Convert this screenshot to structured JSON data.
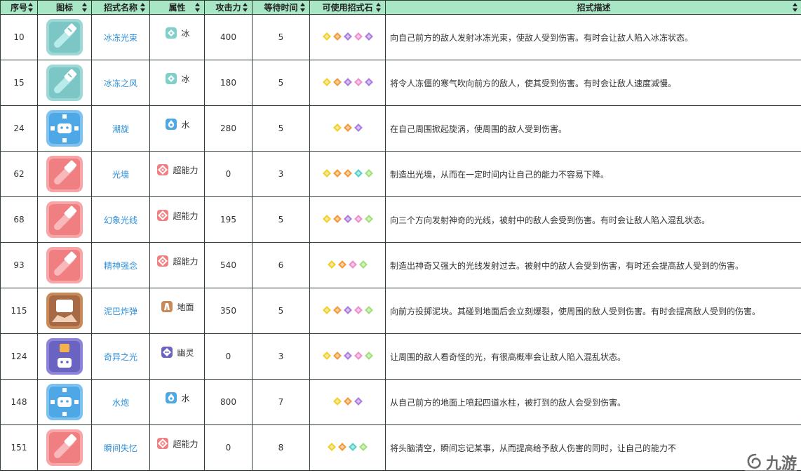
{
  "headers": [
    {
      "key": "idx",
      "label": "序号"
    },
    {
      "key": "icon",
      "label": "图标"
    },
    {
      "key": "name",
      "label": "招式名称"
    },
    {
      "key": "attr",
      "label": "属性"
    },
    {
      "key": "atk",
      "label": "攻击力"
    },
    {
      "key": "wait",
      "label": "等待时间"
    },
    {
      "key": "stones",
      "label": "可使用招式石"
    },
    {
      "key": "desc",
      "label": "招式描述"
    }
  ],
  "colors": {
    "header_bg": "#a9e6c5",
    "link": "#2e8fd8",
    "ice": "#8fd3d6",
    "water": "#4ea8e6",
    "psychic": "#f07f82",
    "ground": "#b06e48",
    "ghost": "#6a63c2"
  },
  "stone_colors": {
    "yellow": "#f2d02a",
    "orange": "#f39a3a",
    "purple": "#a97ee0",
    "pink": "#ee8fc9",
    "green": "#9fe07a",
    "teal": "#56d0c8"
  },
  "rows": [
    {
      "id": "10",
      "name": "冰冻光束",
      "type": "冰",
      "type_key": "ice",
      "icon": "ice-beam-icon",
      "atk": "400",
      "wait": "5",
      "stones": [
        "yellow",
        "orange",
        "purple",
        "pink",
        "purple"
      ],
      "desc": "向自己前方的敌人发射冰冻光束，使敌人受到伤害。有时会让敌人陷入冰冻状态。"
    },
    {
      "id": "15",
      "name": "冰冻之风",
      "type": "冰",
      "type_key": "ice",
      "icon": "ice-wind-icon",
      "atk": "180",
      "wait": "5",
      "stones": [
        "yellow",
        "orange",
        "purple",
        "pink",
        "purple"
      ],
      "desc": "将令人冻僵的寒气吹向前方的敌人，使其受到伤害。有时会让敌人速度减慢。"
    },
    {
      "id": "24",
      "name": "潮旋",
      "type": "水",
      "type_key": "water",
      "icon": "whirlpool-icon",
      "atk": "280",
      "wait": "5",
      "stones": [
        "yellow",
        "orange",
        "purple"
      ],
      "desc": "在自己周围掀起旋涡，使周围的敌人受到伤害。"
    },
    {
      "id": "62",
      "name": "光墙",
      "type": "超能力",
      "type_key": "psychic",
      "icon": "light-screen-icon",
      "atk": "0",
      "wait": "3",
      "stones": [
        "yellow",
        "orange",
        "orange",
        "teal",
        "green"
      ],
      "desc": "制造出光墙，从而在一定时间内让自己的能力不容易下降。"
    },
    {
      "id": "68",
      "name": "幻象光线",
      "type": "超能力",
      "type_key": "psychic",
      "icon": "psybeam-icon",
      "atk": "195",
      "wait": "5",
      "stones": [
        "yellow",
        "orange",
        "purple",
        "pink",
        "green"
      ],
      "desc": "向三个方向发射神奇的光线，被射中的敌人会受到伤害。有时会让敌人陷入混乱状态。"
    },
    {
      "id": "93",
      "name": "精神强念",
      "type": "超能力",
      "type_key": "psychic",
      "icon": "psychic-icon",
      "atk": "540",
      "wait": "6",
      "stones": [
        "yellow",
        "orange",
        "pink",
        "green"
      ],
      "desc": "制造出神奇又强大的光线发射过去。被射中的敌人会受到伤害，有时还会提高敌人受到的伤害。"
    },
    {
      "id": "115",
      "name": "泥巴炸弹",
      "type": "地面",
      "type_key": "ground",
      "icon": "mud-bomb-icon",
      "atk": "350",
      "wait": "5",
      "stones": [
        "yellow",
        "orange",
        "purple",
        "pink",
        "green"
      ],
      "desc": "向前方投掷泥块。其碰到地面后会立刻爆裂，使周围的敌人受到伤害。有时会提高敌人受到的伤害。"
    },
    {
      "id": "124",
      "name": "奇异之光",
      "type": "幽灵",
      "type_key": "ghost",
      "icon": "confuse-ray-icon",
      "atk": "0",
      "wait": "3",
      "stones": [
        "yellow",
        "orange",
        "purple",
        "pink",
        "green"
      ],
      "desc": "让周围的敌人看奇怪的光，有很高概率会让敌人陷入混乱状态。"
    },
    {
      "id": "148",
      "name": "水炮",
      "type": "水",
      "type_key": "water",
      "icon": "hydro-pump-icon",
      "atk": "800",
      "wait": "7",
      "stones": [
        "yellow",
        "orange",
        "purple"
      ],
      "desc": "从自己前方的地面上喷起四道水柱，被打到的敌人会受到伤害。"
    },
    {
      "id": "151",
      "name": "瞬间失忆",
      "type": "超能力",
      "type_key": "psychic",
      "icon": "amnesia-icon",
      "atk": "0",
      "wait": "8",
      "stones": [
        "yellow",
        "orange",
        "teal",
        "green"
      ],
      "desc": "将头脑清空，瞬间忘记某事，从而提高给予敌人伤害的同时，让自己的能力不"
    }
  ],
  "watermark": "九游"
}
